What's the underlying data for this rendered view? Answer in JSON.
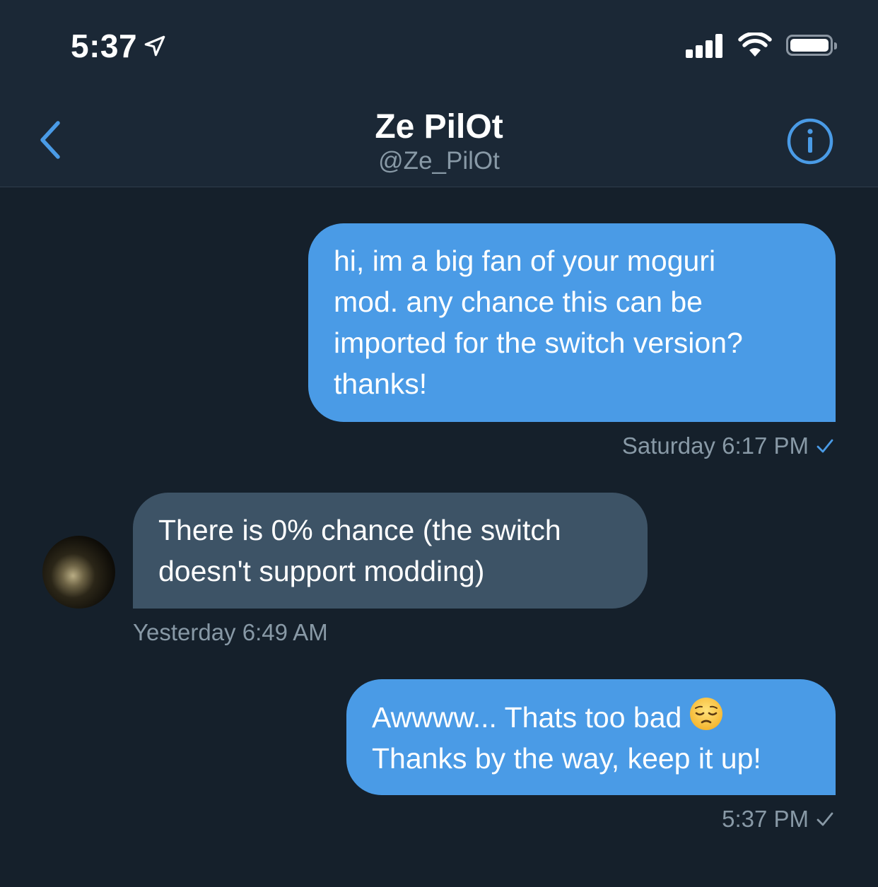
{
  "status_bar": {
    "time": "5:37",
    "location_icon": "location-arrow-icon",
    "signal_icon": "cellular-signal-icon",
    "wifi_icon": "wifi-icon",
    "battery_icon": "battery-icon",
    "battery_level": 1.0
  },
  "header": {
    "back_icon": "chevron-left-icon",
    "name": "Ze PilOt",
    "handle": "@Ze_PilOt",
    "info_icon": "info-circle-icon"
  },
  "colors": {
    "background": "#15202b",
    "header_background": "#1b2836",
    "accent": "#4a9be6",
    "outgoing_bubble": "#4a9be6",
    "incoming_bubble": "#3d5366",
    "secondary_text": "#8899a6"
  },
  "messages": [
    {
      "direction": "outgoing",
      "lines": [
        "hi, im a big fan of your moguri",
        "mod. any chance this can be",
        "imported for the switch version?",
        "thanks!"
      ],
      "timestamp": "Saturday 6:17 PM",
      "status_icon": "checkmark-icon",
      "read": true
    },
    {
      "direction": "incoming",
      "lines": [
        "There is 0% chance (the switch",
        "doesn't support modding)"
      ],
      "timestamp": "Yesterday 6:49 AM",
      "avatar_icon": "avatar"
    },
    {
      "direction": "outgoing",
      "lines": [
        "Awwww... Thats too bad",
        "Thanks by the way, keep it up!"
      ],
      "emoji": "pensive-face-emoji",
      "timestamp": "5:37 PM",
      "status_icon": "checkmark-icon",
      "read": false
    }
  ]
}
